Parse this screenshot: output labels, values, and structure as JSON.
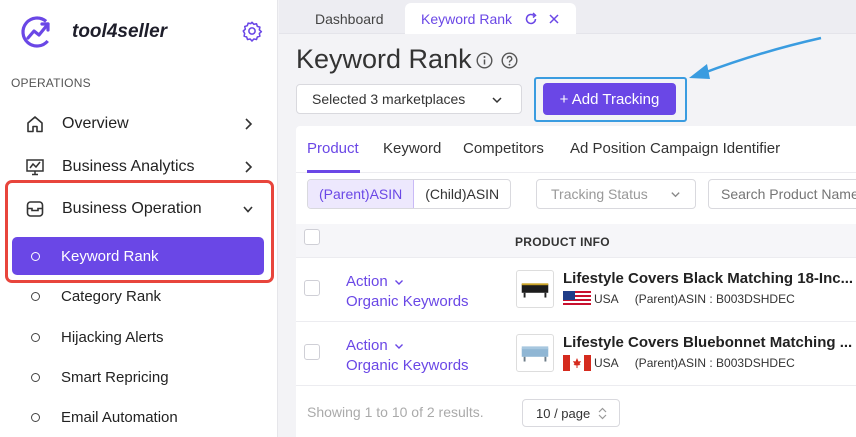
{
  "brand": {
    "name": "tool4seller"
  },
  "sidebar": {
    "section_label": "OPERATIONS",
    "items": [
      {
        "label": "Overview",
        "icon": "home-icon"
      },
      {
        "label": "Business Analytics",
        "icon": "analytics-icon"
      },
      {
        "label": "Business Operation",
        "icon": "inbox-icon",
        "expanded": true
      }
    ],
    "subitems": [
      {
        "label": "Keyword Rank",
        "active": true
      },
      {
        "label": "Category Rank"
      },
      {
        "label": "Hijacking Alerts"
      },
      {
        "label": "Smart Repricing"
      },
      {
        "label": "Email Automation"
      }
    ]
  },
  "tabs": {
    "dashboard": "Dashboard",
    "keyword_rank": "Keyword Rank"
  },
  "page": {
    "title": "Keyword Rank",
    "marketplace_select": "Selected 3 marketplaces",
    "add_button": "+ Add Tracking"
  },
  "subtabs": [
    "Product",
    "Keyword",
    "Competitors",
    "Ad Position Campaign Identifier"
  ],
  "filters": {
    "parent_asin": "(Parent)ASIN",
    "child_asin": "(Child)ASIN",
    "tracking_status_placeholder": "Tracking Status",
    "search_placeholder": "Search Product Name"
  },
  "table": {
    "header": "PRODUCT INFO",
    "rows": [
      {
        "action": "Action",
        "organic": "Organic Keywords",
        "title": "Lifestyle Covers Black Matching 18-Inc...",
        "country": "USA",
        "asin": "(Parent)ASIN : B003DSHDEC"
      },
      {
        "action": "Action",
        "organic": "Organic Keywords",
        "title": "Lifestyle Covers Bluebonnet Matching ...",
        "country": "USA",
        "asin": "(Parent)ASIN : B003DSHDEC"
      }
    ]
  },
  "pager": {
    "summary": "Showing 1 to 10 of 2 results.",
    "page_size": "10 / page"
  },
  "colors": {
    "accent": "#6a47e6",
    "highlight_red": "#e8453c",
    "highlight_blue": "#3a9ce0"
  }
}
